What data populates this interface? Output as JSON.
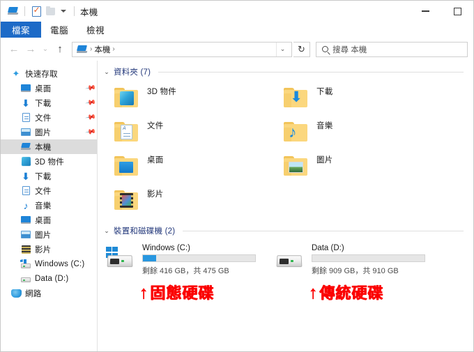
{
  "window": {
    "title": "本機",
    "minimize_label": "最小化",
    "maximize_label": "最大化"
  },
  "quick_access_toolbar": {
    "pc_icon": "pc-icon",
    "properties_icon": "properties-icon",
    "new_folder_icon": "new-folder-icon",
    "customize_icon": "chevron-down-icon"
  },
  "ribbon": {
    "tabs": [
      {
        "label": "檔案",
        "selected": true
      },
      {
        "label": "電腦",
        "selected": false
      },
      {
        "label": "檢視",
        "selected": false
      }
    ]
  },
  "address_bar": {
    "back_icon": "back-arrow-icon",
    "forward_icon": "forward-arrow-icon",
    "recent_icon": "chevron-down-icon",
    "up_icon": "up-arrow-icon",
    "breadcrumbs": [
      "本機"
    ],
    "separator": "›",
    "dropdown_icon": "chevron-down-icon",
    "refresh_icon": "refresh-icon",
    "refresh_glyph": "↻"
  },
  "search": {
    "icon": "search-icon",
    "placeholder": "搜尋 本機"
  },
  "sidebar": {
    "groups": [
      {
        "header": {
          "label": "快速存取",
          "icon": "star-icon"
        },
        "items": [
          {
            "label": "桌面",
            "icon": "desktop-icon",
            "pinned": true
          },
          {
            "label": "下載",
            "icon": "download-icon",
            "pinned": true
          },
          {
            "label": "文件",
            "icon": "document-icon",
            "pinned": true
          },
          {
            "label": "圖片",
            "icon": "pictures-icon",
            "pinned": true
          }
        ]
      },
      {
        "header": {
          "label": "本機",
          "icon": "this-pc-icon",
          "selected": true
        },
        "items": [
          {
            "label": "3D 物件",
            "icon": "3d-objects-icon",
            "pinned": false
          },
          {
            "label": "下載",
            "icon": "download-icon",
            "pinned": false
          },
          {
            "label": "文件",
            "icon": "document-icon",
            "pinned": false
          },
          {
            "label": "音樂",
            "icon": "music-icon",
            "pinned": false
          },
          {
            "label": "桌面",
            "icon": "desktop-icon",
            "pinned": false
          },
          {
            "label": "圖片",
            "icon": "pictures-icon",
            "pinned": false
          },
          {
            "label": "影片",
            "icon": "videos-icon",
            "pinned": false
          },
          {
            "label": "Windows (C:)",
            "icon": "windows-drive-icon",
            "pinned": false
          },
          {
            "label": "Data (D:)",
            "icon": "drive-icon",
            "pinned": false
          }
        ]
      },
      {
        "header": {
          "label": "網路",
          "icon": "network-icon"
        },
        "items": []
      }
    ]
  },
  "content": {
    "folders_section": {
      "title": "資料夾 (7)",
      "chevron": "⌄",
      "items": [
        {
          "label": "3D 物件",
          "icon": "folder-3d-objects-icon"
        },
        {
          "label": "下載",
          "icon": "folder-downloads-icon"
        },
        {
          "label": "文件",
          "icon": "folder-documents-icon"
        },
        {
          "label": "音樂",
          "icon": "folder-music-icon"
        },
        {
          "label": "桌面",
          "icon": "folder-desktop-icon"
        },
        {
          "label": "圖片",
          "icon": "folder-pictures-icon"
        },
        {
          "label": "影片",
          "icon": "folder-videos-icon"
        }
      ]
    },
    "drives_section": {
      "title": "裝置和磁碟機 (2)",
      "chevron": "⌄",
      "items": [
        {
          "name": "Windows (C:)",
          "icon": "windows-drive-icon",
          "capacity_text": "剩餘 416 GB，共 475 GB",
          "free_gb": 416,
          "total_gb": 475,
          "used_percent": 12,
          "bar_color": "#2897e0"
        },
        {
          "name": "Data (D:)",
          "icon": "drive-icon",
          "capacity_text": "剩餘 909 GB，共 910 GB",
          "free_gb": 909,
          "total_gb": 910,
          "used_percent": 0,
          "bar_color": "#2897e0"
        }
      ]
    },
    "annotations": [
      {
        "arrow": "↑",
        "text": "固態硬碟",
        "color": "#fb0000"
      },
      {
        "arrow": "↑",
        "text": "傳統硬碟",
        "color": "#fb0000"
      }
    ]
  }
}
